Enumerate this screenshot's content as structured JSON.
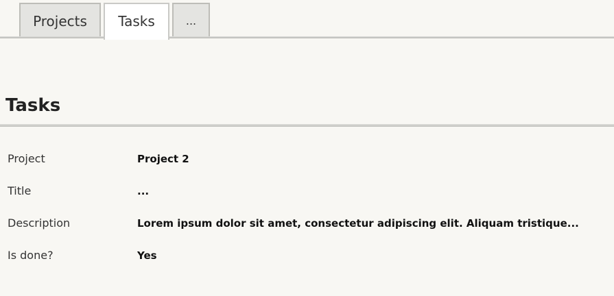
{
  "tabs": {
    "projects": "Projects",
    "tasks": "Tasks",
    "more": "..."
  },
  "page": {
    "title": "Tasks"
  },
  "details": {
    "project": {
      "label": "Project",
      "value": "Project 2"
    },
    "title": {
      "label": "Title",
      "value": "..."
    },
    "description": {
      "label": "Description",
      "value": "Lorem ipsum dolor sit amet, consectetur adipiscing elit. Aliquam tristique..."
    },
    "is_done": {
      "label": "Is done?",
      "value": "Yes"
    }
  }
}
